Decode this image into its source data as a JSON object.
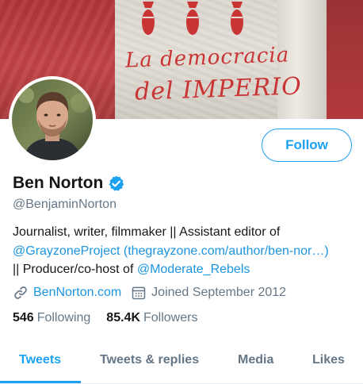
{
  "banner": {
    "graffiti_line1": "La democracia",
    "graffiti_line2": "del IMPERIO"
  },
  "profile": {
    "display_name": "Ben Norton",
    "verified": true,
    "handle": "@BenjaminNorton",
    "follow_label": "Follow",
    "bio": {
      "line1": "Journalist, writer, filmmaker || Assistant editor of",
      "mention_grayzone": "@GrayzoneProject",
      "url_grayzone": "(thegrayzone.com/author/ben-nor…)",
      "line3_prefix": "|| Producer/co-host of ",
      "mention_moderate": "@Moderate_Rebels"
    },
    "website": "BenNorton.com",
    "joined": "Joined September 2012",
    "following_count": "546",
    "following_label": "Following",
    "followers_count": "85.4K",
    "followers_label": "Followers"
  },
  "tabs": [
    {
      "label": "Tweets",
      "active": true
    },
    {
      "label": "Tweets & replies",
      "active": false
    },
    {
      "label": "Media",
      "active": false
    },
    {
      "label": "Likes",
      "active": false
    }
  ],
  "colors": {
    "accent": "#1da1f2",
    "link": "#1b95e0",
    "secondary_text": "#657786",
    "primary_text": "#14171a",
    "graffiti": "#c93434"
  },
  "icons": [
    "link-icon",
    "calendar-icon",
    "verified-badge-icon"
  ]
}
